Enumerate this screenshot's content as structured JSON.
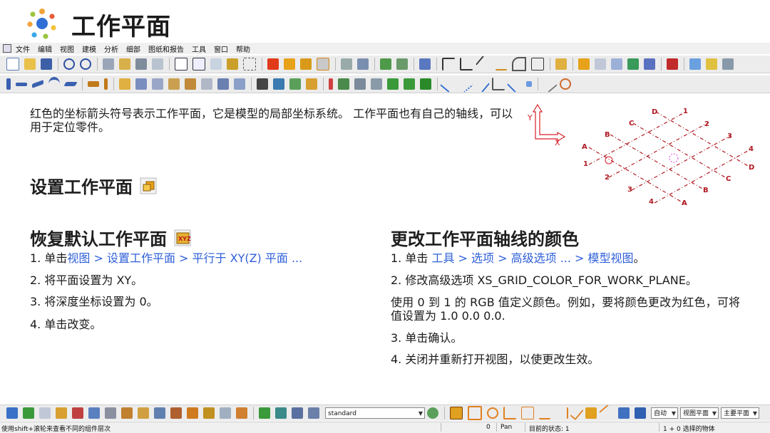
{
  "header": {
    "title": "工作平面"
  },
  "menu": [
    "文件",
    "编辑",
    "视图",
    "建模",
    "分析",
    "细部",
    "图纸和报告",
    "工具",
    "窗口",
    "帮助"
  ],
  "intro": "红色的坐标箭头符号表示工作平面，它是模型的局部坐标系统。 工作平面也有自己的轴线，可以用于定位零件。",
  "section_set": {
    "heading": "设置工作平面"
  },
  "section_restore": {
    "heading": "恢复默认工作平面",
    "icon_text": "XYZ",
    "step1_prefix": "1. 单击",
    "step1_link": "视图 > 设置工作平面 > 平行于 XY(Z) 平面 ...",
    "step2": "2. 将平面设置为 XY。",
    "step3": "3. 将深度坐标设置为 0。",
    "step4": "4. 单击改变。"
  },
  "section_color": {
    "heading": "更改工作平面轴线的颜色",
    "step1_prefix": "1. 单击 ",
    "step1_link": "工具 > 选项 > 高级选项 ... > 模型视图",
    "step1_suffix": "。",
    "step2": "2. 修改高级选项 XS_GRID_COLOR_FOR_WORK_PLANE。",
    "note": "使用 0 到 1 的 RGB 值定义颜色。例如，要将颜色更改为红色，可将值设置为 1.0 0.0 0.0.",
    "step3": "3. 单击确认。",
    "step4": "4. 关闭并重新打开视图，以使更改生效。"
  },
  "diagram": {
    "axis_y": "Y",
    "axis_x": "X",
    "letters": [
      "A",
      "B",
      "C",
      "D"
    ],
    "numbers": [
      "1",
      "2",
      "3",
      "4"
    ]
  },
  "toolbar_bottom": {
    "standard": "standard",
    "combo1": "自动",
    "combo2": "视图平面",
    "combo3": "主要平面"
  },
  "status": {
    "hint": "使用shift+滚轮来查看不同的组件层次",
    "zero": "0",
    "pan": "Pan",
    "state": "目前的状态: 1",
    "selected": "1 + 0 选择的物体"
  },
  "colors": {
    "accent_blue": "#2e5fd8",
    "diagram_red": "#d8202a",
    "toolbar_bg": "#ececec"
  }
}
